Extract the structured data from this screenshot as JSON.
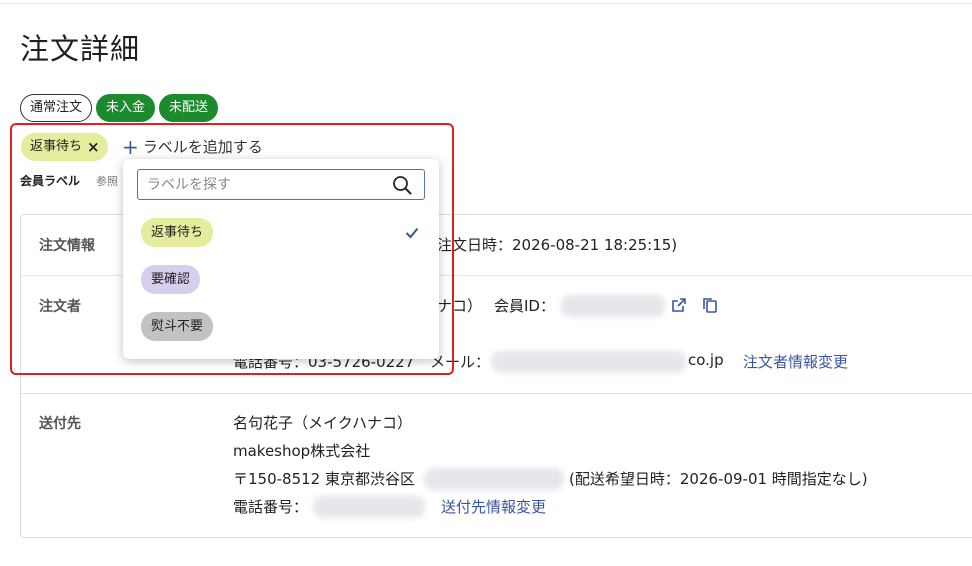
{
  "page": {
    "title": "注文詳細"
  },
  "status_badges": [
    {
      "label": "通常注文",
      "style": "outline"
    },
    {
      "label": "未入金",
      "style": "green"
    },
    {
      "label": "未配送",
      "style": "green"
    }
  ],
  "labels": {
    "applied": [
      {
        "label": "返事待ち",
        "color": "#e6ec9e"
      }
    ],
    "add_button": "ラベルを追加する",
    "member_label": "会員ラベル",
    "member_hint": "参照",
    "dropdown": {
      "search_placeholder": "ラベルを探す",
      "options": [
        {
          "label": "返事待ち",
          "color": "#e6ec9e",
          "selected": true
        },
        {
          "label": "要確認",
          "color": "#d9cdee",
          "selected": false
        },
        {
          "label": "熨斗不要",
          "color": "#c2c2c2",
          "selected": false
        }
      ]
    }
  },
  "order_info": {
    "label": "注文情報",
    "text": "注文日時：2026-08-21 18:25:15)"
  },
  "orderer": {
    "label": "注文者",
    "name_tail": "ナコ）",
    "member_id_label": "会員ID：",
    "phone_partial": "電話番号：03-5726-0227",
    "mail_label": "メール：",
    "mail_tail": "co.jp",
    "change_link": "注文者情報変更"
  },
  "shipping": {
    "label": "送付先",
    "name": "名句花子（メイクハナコ）",
    "company": "makeshop株式会社",
    "address_prefix": "〒150-8512 東京都渋谷区",
    "delivery_note": "(配送希望日時：2026-09-01 時間指定なし)",
    "phone_label": "電話番号：",
    "change_link": "送付先情報変更"
  },
  "colors": {
    "accent": "#3a55a4",
    "green": "#1b8b2e",
    "highlight": "#e02020"
  }
}
